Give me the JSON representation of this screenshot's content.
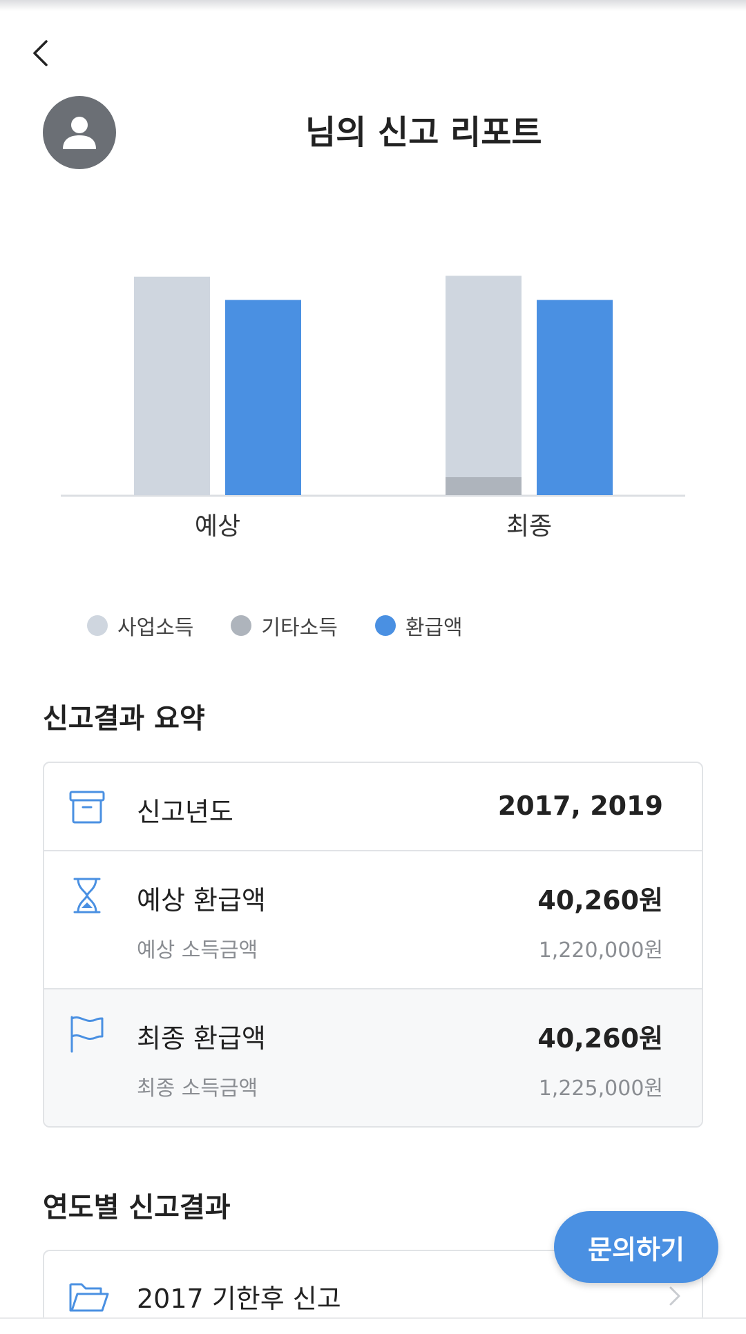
{
  "header": {
    "title": "님의 신고 리포트"
  },
  "chart_data": {
    "type": "bar",
    "categories": [
      "예상",
      "최종"
    ],
    "series": [
      {
        "name": "사업소득",
        "values": [
          1220000,
          1225000
        ],
        "color": "#cfd6df"
      },
      {
        "name": "기타소득",
        "values": [
          0,
          100000
        ],
        "color": "#aeb4bc"
      },
      {
        "name": "환급액",
        "values": [
          40260,
          40260
        ],
        "color": "#4a90e2"
      }
    ],
    "legend_position": "bottom"
  },
  "legend": [
    {
      "label": "사업소득",
      "color": "#cfd6df"
    },
    {
      "label": "기타소득",
      "color": "#aeb4bc"
    },
    {
      "label": "환급액",
      "color": "#4a90e2"
    }
  ],
  "summary": {
    "title": "신고결과 요약",
    "year": {
      "label": "신고년도",
      "value": "2017, 2019",
      "icon": "archive-box-icon"
    },
    "expected": {
      "label": "예상 환급액",
      "value": "40,260원",
      "sub_label": "예상 소득금액",
      "sub_value": "1,220,000원",
      "icon": "hourglass-icon"
    },
    "final": {
      "label": "최종 환급액",
      "value": "40,260원",
      "sub_label": "최종 소득금액",
      "sub_value": "1,225,000원",
      "icon": "flag-icon"
    }
  },
  "yearly": {
    "title": "연도별 신고결과",
    "items": [
      {
        "label": "2017 기한후 신고",
        "icon": "folder-open-icon"
      }
    ]
  },
  "inquiry_button": "문의하기",
  "colors": {
    "accent": "#4a90e2",
    "business_income": "#cfd6df",
    "other_income": "#aeb4bc",
    "refund": "#4a90e2"
  }
}
